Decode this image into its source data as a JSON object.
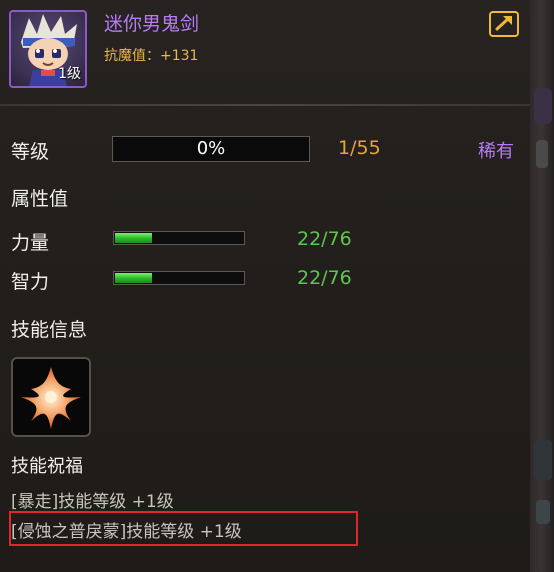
{
  "item": {
    "name": "迷你男鬼剑",
    "level_badge": "1级",
    "resist_label": "抗魔值：+131"
  },
  "icons": {
    "share": "share-arrow-icon",
    "skill": "flame-star-icon"
  },
  "level": {
    "label": "等级",
    "progress_text": "0%",
    "progress": 0,
    "count": "1/55",
    "rarity": "稀有"
  },
  "attributes": {
    "heading": "属性值",
    "items": [
      {
        "label": "力量",
        "value": "22/76",
        "current": 22,
        "max": 76
      },
      {
        "label": "智力",
        "value": "22/76",
        "current": 22,
        "max": 76
      }
    ]
  },
  "skill": {
    "heading": "技能信息",
    "bless_heading": "技能祝福",
    "blessings": [
      "[暴走]技能等级 +1级",
      "[侵蚀之普戾蒙]技能等级 +1级"
    ]
  },
  "colors": {
    "name": "#b77cf5",
    "resist": "#e8b84c",
    "level_count": "#e8a33a",
    "rarity": "#b77cf5",
    "stat_value": "#5ec84c",
    "stat_fill": "#2fb62a",
    "highlight": "#e0262a"
  }
}
